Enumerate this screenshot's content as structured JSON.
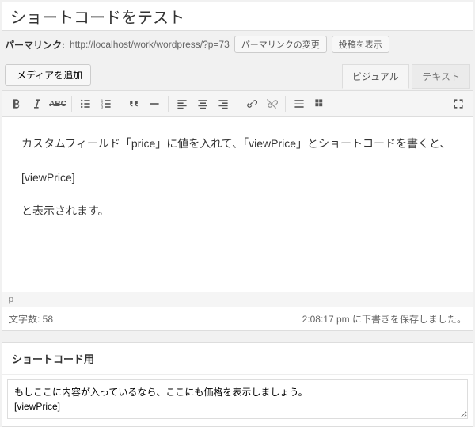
{
  "title": "ショートコードをテスト",
  "permalink": {
    "label": "パーマリンク:",
    "url": "http://localhost/work/wordpress/?p=73",
    "change_btn": "パーマリンクの変更",
    "view_btn": "投稿を表示"
  },
  "media_button": "メディアを追加",
  "tabs": {
    "visual": "ビジュアル",
    "text": "テキスト"
  },
  "content": {
    "p1": "カスタムフィールド「price」に値を入れて、「viewPrice」とショートコードを書くと、",
    "p2": "[viewPrice]",
    "p3": "と表示されます。"
  },
  "path": "p",
  "status": {
    "word_count_label": "文字数: ",
    "word_count": "58",
    "saved": "2:08:17 pm に下書きを保存しました。"
  },
  "meta": {
    "title": "ショートコード用",
    "body": "もしここに内容が入っているなら、ここにも価格を表示しましょう。\n[viewPrice]"
  }
}
